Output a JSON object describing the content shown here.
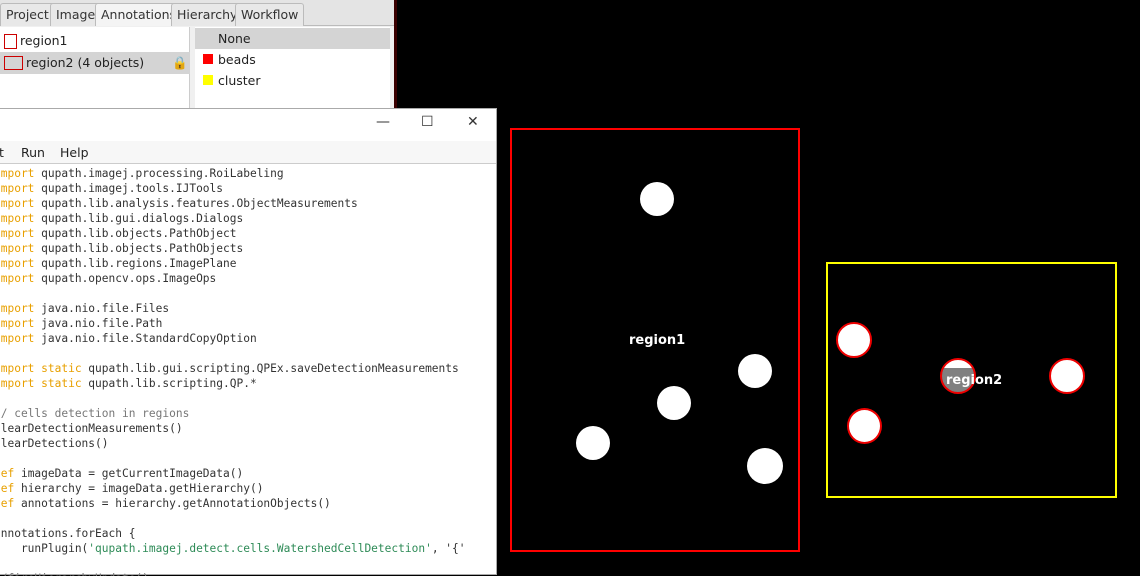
{
  "tabs": [
    "Project",
    "Image",
    "Annotations",
    "Hierarchy",
    "Workflow"
  ],
  "annotations": [
    {
      "name": "region1",
      "color": "#c00000"
    },
    {
      "name": "region2 (4 objects)",
      "color": "#c00000",
      "locked": true
    }
  ],
  "classes": [
    {
      "name": "None"
    },
    {
      "name": "beads",
      "color": "#ff0000"
    },
    {
      "name": "cluster",
      "color": "#ffff00"
    }
  ],
  "editor": {
    "menus": [
      "t",
      "Run",
      "Help"
    ],
    "minimize": "—",
    "maximize": "☐",
    "close": "✕"
  },
  "code": [
    {
      "k": "import",
      "t": " qupath.imagej.processing.RoiLabeling"
    },
    {
      "k": "import",
      "t": " qupath.imagej.tools.IJTools"
    },
    {
      "k": "import",
      "t": " qupath.lib.analysis.features.ObjectMeasurements"
    },
    {
      "k": "import",
      "t": " qupath.lib.gui.dialogs.Dialogs"
    },
    {
      "k": "import",
      "t": " qupath.lib.objects.PathObject"
    },
    {
      "k": "import",
      "t": " qupath.lib.objects.PathObjects"
    },
    {
      "k": "import",
      "t": " qupath.lib.regions.ImagePlane"
    },
    {
      "k": "import",
      "t": " qupath.opencv.ops.ImageOps"
    },
    {
      "t": ""
    },
    {
      "k": "import",
      "t": " java.nio.file.Files"
    },
    {
      "k": "import",
      "t": " java.nio.file.Path"
    },
    {
      "k": "import",
      "t": " java.nio.file.StandardCopyOption"
    },
    {
      "t": ""
    },
    {
      "k": "import static",
      "t": " qupath.lib.gui.scripting.QPEx.saveDetectionMeasurements"
    },
    {
      "k": "import static",
      "t": " qupath.lib.scripting.QP.*"
    },
    {
      "t": ""
    },
    {
      "c": "// cells detection in regions"
    },
    {
      "t": "clearDetectionMeasurements()"
    },
    {
      "t": "clearDetections()"
    },
    {
      "t": ""
    },
    {
      "k": "def",
      "t": " imageData = getCurrentImageData()"
    },
    {
      "k": "def",
      "t": " hierarchy = imageData.getHierarchy()"
    },
    {
      "k": "def",
      "t": " annotations = hierarchy.getAnnotationObjects()"
    },
    {
      "t": ""
    },
    {
      "t": "annotations.forEach {"
    },
    {
      "t": "    runPlugin(",
      "s": "'qupath.imagej.detect.cells.WatershedCellDetection'",
      "e": ", '{'"
    },
    {
      "t": "}"
    },
    {
      "c": "//fireHierarchyUpdate()"
    }
  ],
  "viewer": {
    "region1_label": "region1",
    "region2_label": "region2",
    "region1_color": "#ff0000",
    "region2_color": "#ffff00"
  }
}
